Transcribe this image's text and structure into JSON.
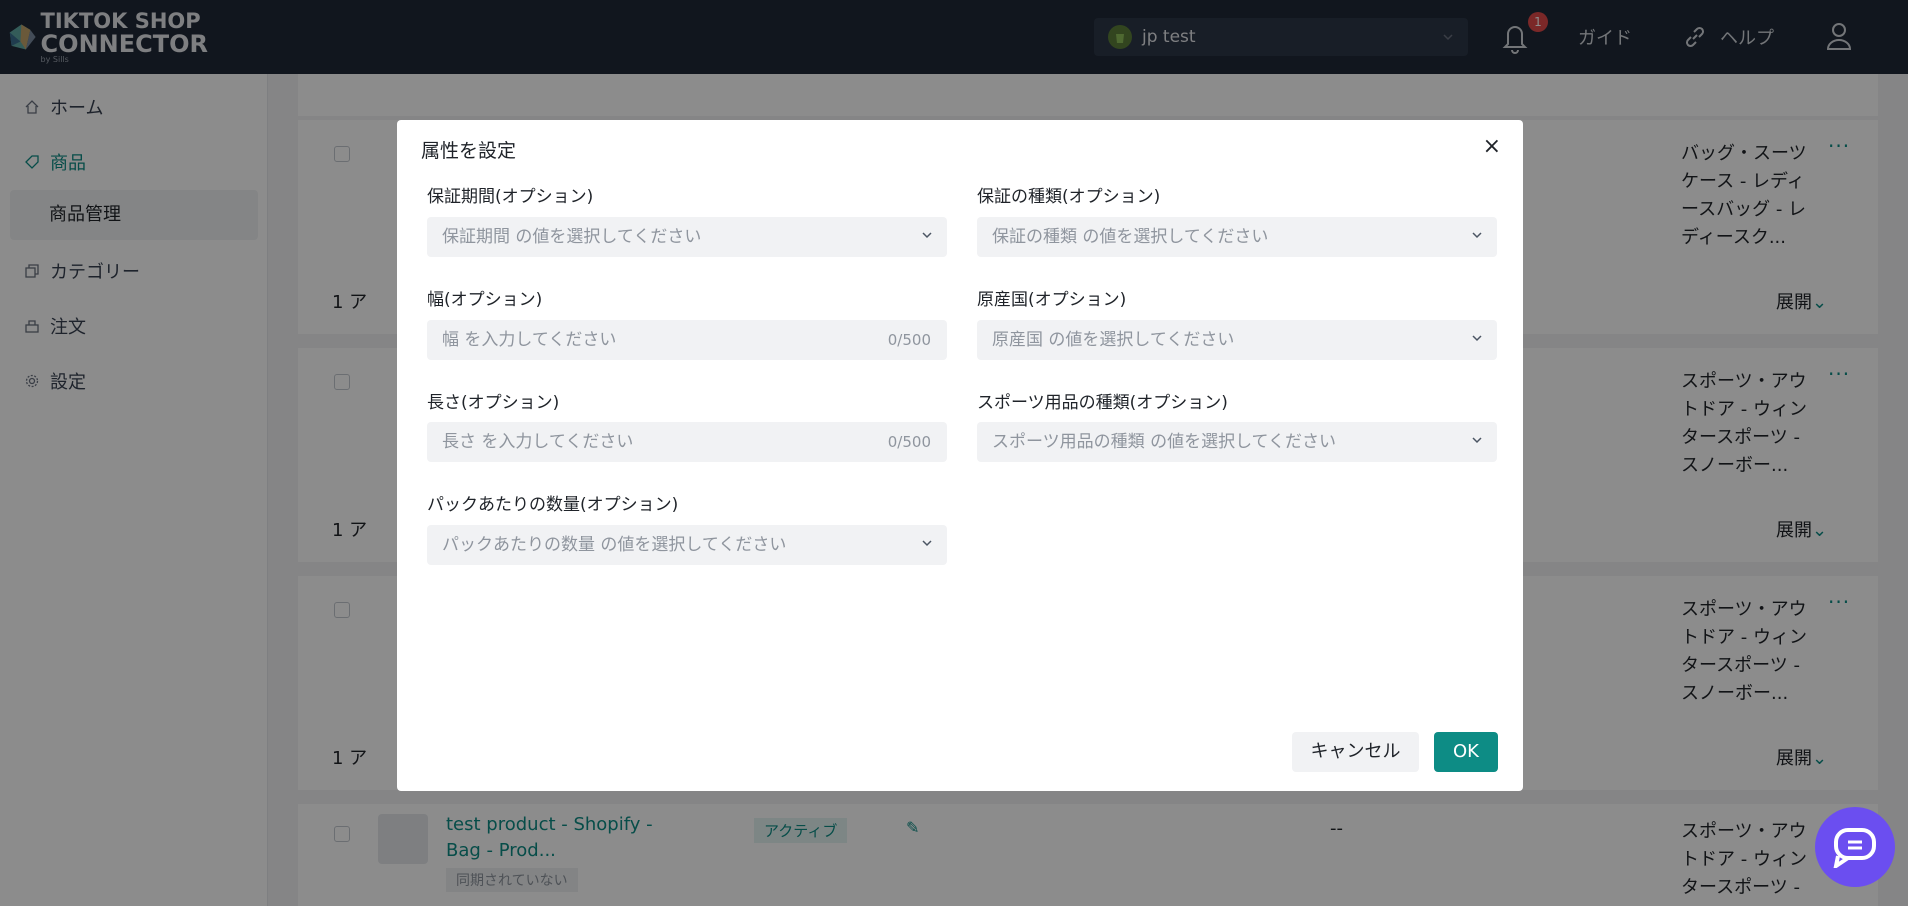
{
  "header": {
    "logo_line1": "TIKTOK SHOP",
    "logo_line2": "CONNECTOR",
    "logo_line3": "by Sills",
    "store_name": "jp test",
    "notification_count": "1",
    "guide_label": "ガイド",
    "help_label": "ヘルプ"
  },
  "sidebar": {
    "items": [
      {
        "label": "ホーム",
        "icon": "home-icon"
      },
      {
        "label": "商品",
        "icon": "tag-icon"
      },
      {
        "label": "商品管理"
      },
      {
        "label": "カテゴリー",
        "icon": "category-icon"
      },
      {
        "label": "注文",
        "icon": "order-icon"
      },
      {
        "label": "設定",
        "icon": "gear-icon"
      }
    ]
  },
  "background": {
    "rows": [
      {
        "category": "バッグ・スーツケース - レディースバッグ - レディースク..."
      },
      {
        "category": "スポーツ・アウトドア - ウィンタースポーツ - スノーボー..."
      },
      {
        "category": "スポーツ・アウトドア - ウィンタースポーツ - スノーボー..."
      },
      {
        "category": "スポーツ・アウトドア - ウィンタースポーツ - スノー"
      }
    ],
    "group_label": "1 ア",
    "expand_label": "展開",
    "product_name": "test product - Shopify - Bag - Prod...",
    "product_status": "アクティブ",
    "product_sync": "同期されていない",
    "product_price": "--"
  },
  "modal": {
    "title": "属性を設定",
    "close": "×",
    "fields": [
      {
        "label": "保証期間(オプション)",
        "placeholder": "保証期間 の値を選択してください",
        "type": "select"
      },
      {
        "label": "保証の種類(オプション)",
        "placeholder": "保証の種類 の値を選択してください",
        "type": "select"
      },
      {
        "label": "幅(オプション)",
        "placeholder": "幅 を入力してください",
        "type": "input",
        "count": "0/500"
      },
      {
        "label": "原産国(オプション)",
        "placeholder": "原産国 の値を選択してください",
        "type": "select"
      },
      {
        "label": "長さ(オプション)",
        "placeholder": "長さ を入力してください",
        "type": "input",
        "count": "0/500"
      },
      {
        "label": "スポーツ用品の種類(オプション)",
        "placeholder": "スポーツ用品の種類 の値を選択してください",
        "type": "select"
      },
      {
        "label": "パックあたりの数量(オプション)",
        "placeholder": "パックあたりの数量 の値を選択してください",
        "type": "select"
      }
    ],
    "cancel_label": "キャンセル",
    "ok_label": "OK"
  },
  "colors": {
    "accent": "#0d8c85",
    "topbar": "#1f2937",
    "chat": "#6b4ef0",
    "badge": "#e04a4a"
  }
}
